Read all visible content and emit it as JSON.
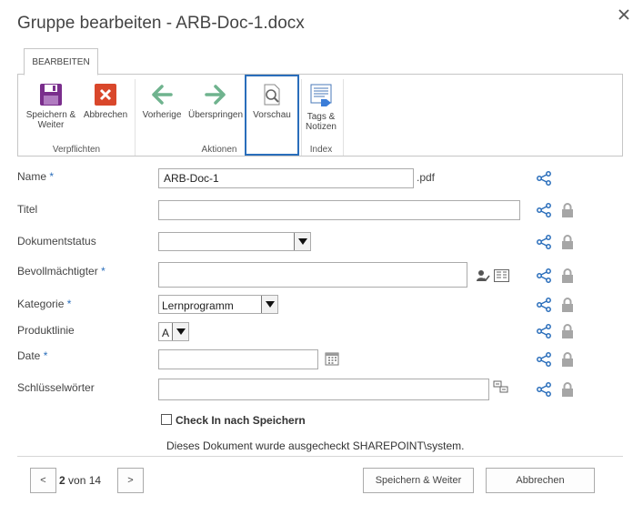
{
  "dialog": {
    "title": "Gruppe bearbeiten - ARB-Doc-1.docx"
  },
  "ribbon": {
    "tab": "BEARBEITEN",
    "groups": {
      "commit": "Verpflichten",
      "actions": "Aktionen",
      "index": "Index"
    },
    "buttons": {
      "save_line1": "Speichern &",
      "save_line2": "Weiter",
      "cancel": "Abbrechen",
      "prev": "Vorherige",
      "skip": "Überspringen",
      "preview": "Vorschau",
      "tags_line1": "Tags &",
      "tags_line2": "Notizen"
    }
  },
  "form": {
    "name": {
      "label": "Name",
      "value": "ARB-Doc-1",
      "suffix": ".pdf"
    },
    "title": {
      "label": "Titel",
      "value": ""
    },
    "docstatus": {
      "label": "Dokumentstatus",
      "value": ""
    },
    "delegate": {
      "label": "Bevollmächtigter",
      "value": ""
    },
    "category": {
      "label": "Kategorie",
      "value": "Lernprogramm"
    },
    "product": {
      "label": "Produktlinie",
      "value": "A"
    },
    "date": {
      "label": "Date",
      "value": ""
    },
    "keywords": {
      "label": "Schlüsselwörter",
      "value": ""
    },
    "required_marker": "*"
  },
  "checkin": {
    "label": "Check In nach Speichern",
    "checked": false
  },
  "status_text": "Dieses Dokument wurde ausgecheckt SHAREPOINT\\system.",
  "pager": {
    "prev": "<",
    "current": "2",
    "of_text": "von 14",
    "next": ">"
  },
  "footer": {
    "save": "Speichern & Weiter",
    "cancel": "Abbrechen"
  },
  "colors": {
    "accent": "#2a6ebb",
    "save_purple": "#7a2e8c",
    "cancel_red": "#d9472b",
    "arrow_green": "#6fb38e"
  }
}
